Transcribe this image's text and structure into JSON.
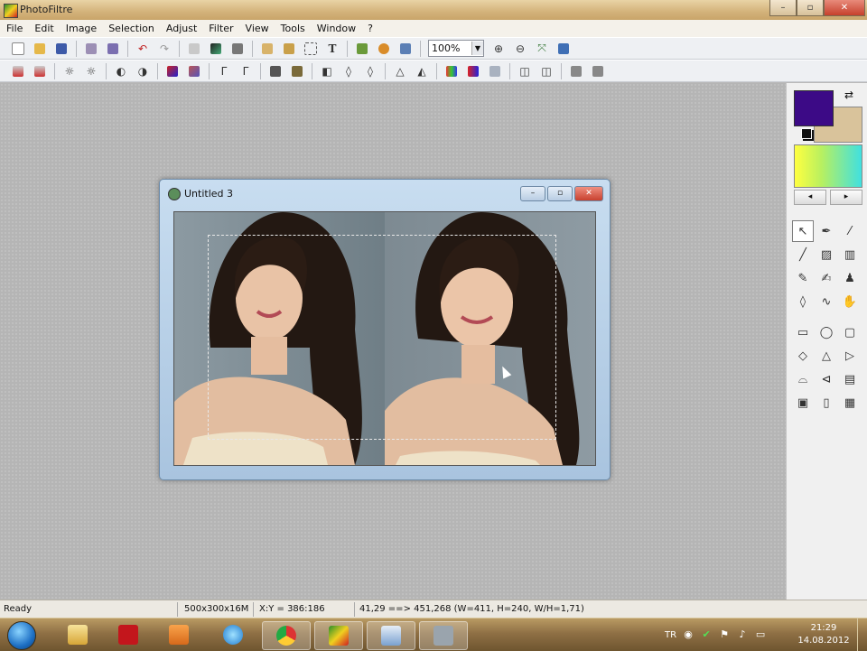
{
  "app": {
    "title": "PhotoFiltre",
    "window_controls": {
      "minimize": "–",
      "maximize": "▫",
      "close": "✕"
    }
  },
  "menu": [
    "File",
    "Edit",
    "Image",
    "Selection",
    "Adjust",
    "Filter",
    "View",
    "Tools",
    "Window",
    "?"
  ],
  "toolbar": {
    "zoom_value": "100%",
    "icons_row1": [
      "new-icon",
      "open-icon",
      "save-icon",
      "print-icon",
      "scan-icon",
      "undo-icon",
      "redo-icon",
      "copy-icon",
      "paste-icon",
      "paste-new-icon",
      "crop-icon",
      "text-icon",
      "plugin-icon",
      "automate-icon",
      "window-icon",
      "zoom-in-icon",
      "zoom-out-icon",
      "fit-icon",
      "fullscreen-icon"
    ],
    "icons_row2": [
      "auto-levels-icon",
      "auto-contrast-icon",
      "brightness-up-icon",
      "brightness-down-icon",
      "contrast-up-icon",
      "contrast-down-icon",
      "saturation-up-icon",
      "saturation-down-icon",
      "gamma-up-icon",
      "gamma-down-icon",
      "grayscale-icon",
      "sepia-icon",
      "mirror-icon",
      "blur-icon",
      "sharpen-icon",
      "soften-icon",
      "emboss-icon",
      "colorize-icon",
      "rgb-icon",
      "invert-icon",
      "flip-h-icon",
      "flip-v-icon",
      "rotate-left-icon",
      "rotate-right-icon"
    ]
  },
  "document": {
    "title": "Untitled 3",
    "controls": {
      "minimize": "–",
      "maximize": "▫",
      "close": "✕"
    }
  },
  "colors": {
    "foreground": "#3c0a86",
    "background": "#d9c39b",
    "gradient_from": "#ffff40",
    "gradient_to": "#40e0e0"
  },
  "palette_arrows": {
    "left": "◂",
    "right": "▸"
  },
  "tools": [
    {
      "name": "selection-tool-icon",
      "glyph": "↖",
      "selected": true
    },
    {
      "name": "eyedropper-icon",
      "glyph": "✒"
    },
    {
      "name": "magic-wand-icon",
      "glyph": "⁄"
    },
    {
      "name": "line-icon",
      "glyph": "╱"
    },
    {
      "name": "fill-bucket-icon",
      "glyph": "▨"
    },
    {
      "name": "spray-icon",
      "glyph": "▥"
    },
    {
      "name": "brush-icon",
      "glyph": "✎"
    },
    {
      "name": "advanced-brush-icon",
      "glyph": "✍"
    },
    {
      "name": "stamp-icon",
      "glyph": "♟"
    },
    {
      "name": "blur-drop-icon",
      "glyph": "◊"
    },
    {
      "name": "smudge-icon",
      "glyph": "∿"
    },
    {
      "name": "hand-icon",
      "glyph": "✋"
    }
  ],
  "shapes": [
    {
      "name": "rectangle-icon",
      "glyph": "▭"
    },
    {
      "name": "ellipse-icon",
      "glyph": "◯"
    },
    {
      "name": "rounded-rect-icon",
      "glyph": "▢"
    },
    {
      "name": "diamond-icon",
      "glyph": "◇"
    },
    {
      "name": "triangle-icon",
      "glyph": "△"
    },
    {
      "name": "arrow-shape-icon",
      "glyph": "▷"
    },
    {
      "name": "lasso-icon",
      "glyph": "⌓"
    },
    {
      "name": "polygon-icon",
      "glyph": "⊲"
    },
    {
      "name": "load-shape-icon",
      "glyph": "▤"
    },
    {
      "name": "fill-mode-icon",
      "glyph": "▣"
    },
    {
      "name": "outline-mode-icon",
      "glyph": "▯"
    },
    {
      "name": "border-mode-icon",
      "glyph": "▦"
    }
  ],
  "status": {
    "ready": "Ready",
    "image_info": "500x300x16M",
    "coords": "X:Y = 386:186",
    "selection": "41,29 ==> 451,268 (W=411, H=240, W/H=1,71)"
  },
  "taskbar": {
    "apps": [
      "start-orb",
      "explorer-icon",
      "acrobat-icon",
      "media-player-icon",
      "ie-icon",
      "chrome-icon",
      "photofiltre-icon",
      "paint-icon",
      "camera-icon"
    ],
    "language": "TR",
    "time": "21:29",
    "date": "14.08.2012"
  }
}
